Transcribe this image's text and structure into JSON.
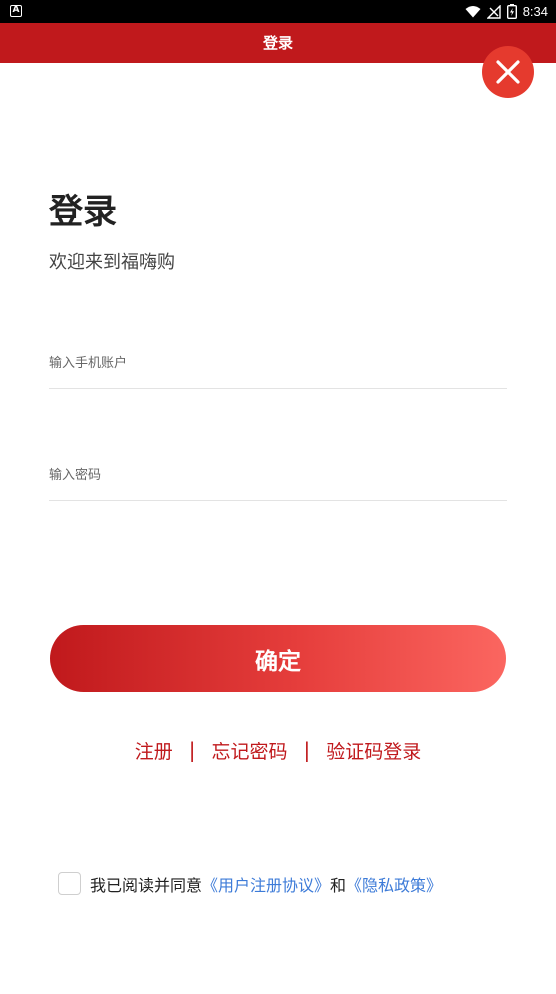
{
  "status_bar": {
    "app_badge": "A",
    "time": "8:34"
  },
  "header": {
    "title": "登录"
  },
  "main": {
    "heading": "登录",
    "welcome": "欢迎来到福嗨购",
    "phone_input": {
      "placeholder": "输入手机账户",
      "value": ""
    },
    "password_input": {
      "placeholder": "输入密码",
      "value": ""
    },
    "confirm_label": "确定",
    "links": {
      "register": "注册",
      "separator": "|",
      "forgot_password": "忘记密码",
      "sms_login": "验证码登录"
    },
    "agreement": {
      "prefix": "我已阅读并同意",
      "user_agreement": "《用户注册协议》",
      "and": "和",
      "privacy_policy": "《隐私政策》",
      "checked": false
    }
  },
  "colors": {
    "brand_red": "#c0191c",
    "close_button": "#e53a2e",
    "link_blue": "#3d7bd8"
  },
  "icons": {
    "close": "close-icon",
    "wifi": "wifi-icon",
    "signal": "signal-icon",
    "battery": "battery-icon"
  }
}
